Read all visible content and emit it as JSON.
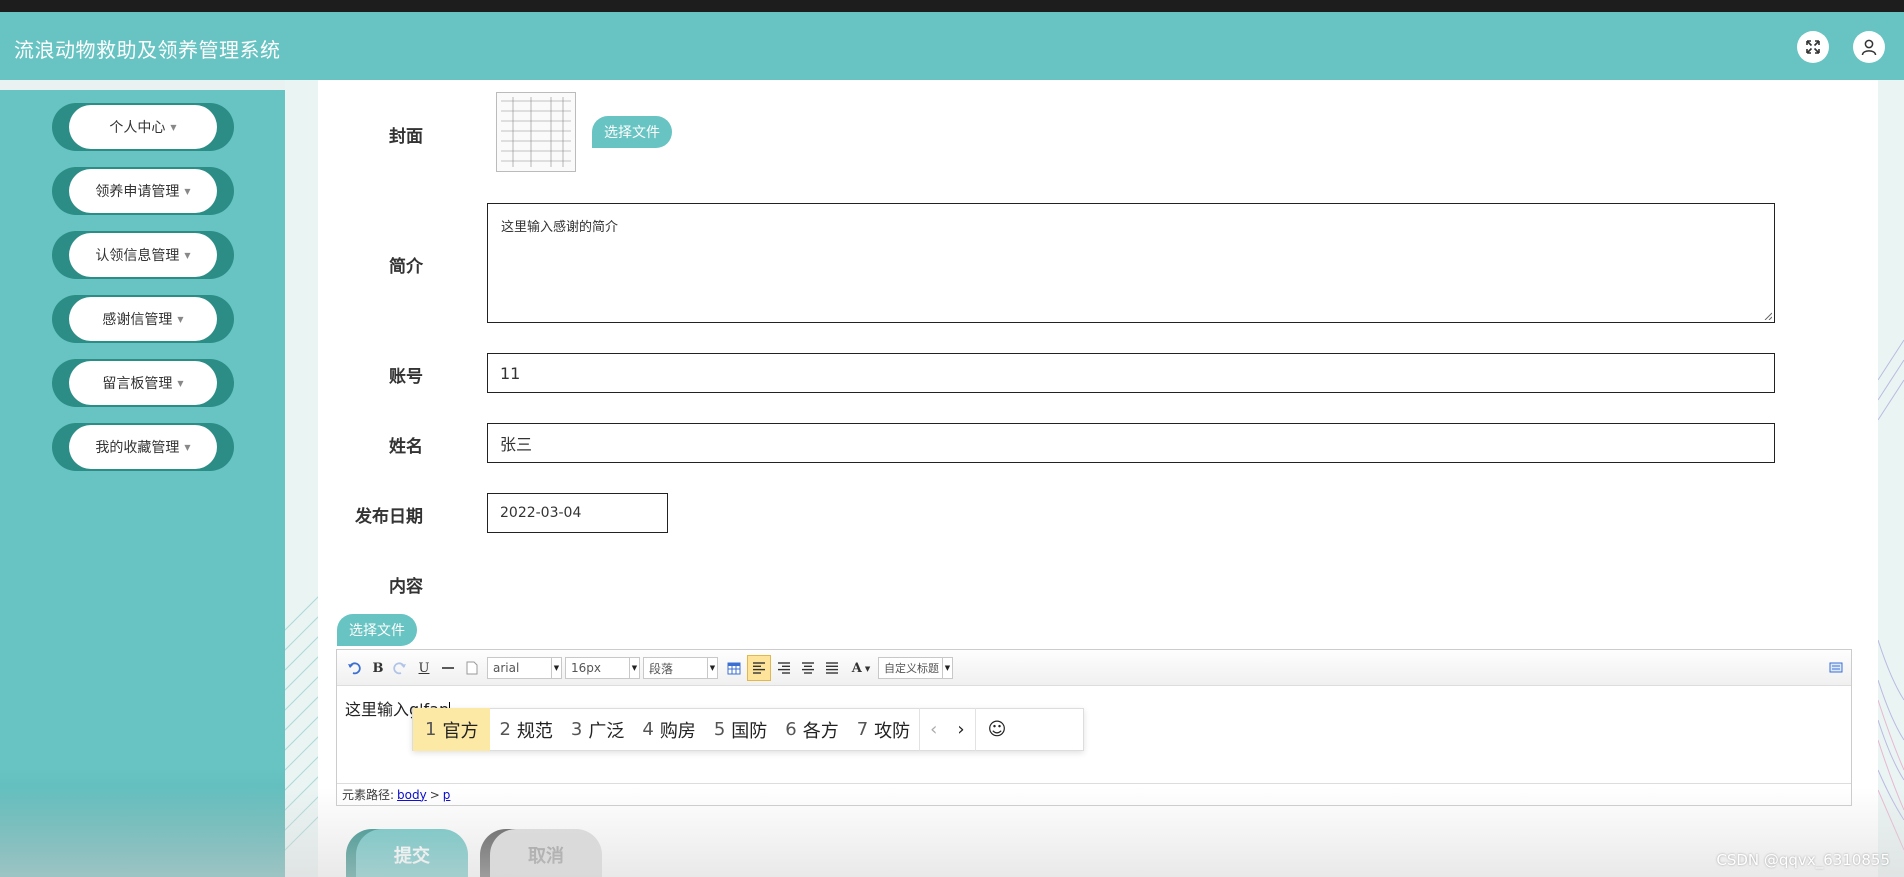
{
  "app": {
    "title": "流浪动物救助及领养管理系统"
  },
  "header": {
    "fullscreen_icon": "expand-arrows-icon",
    "user_icon": "user-avatar-icon"
  },
  "sidebar": {
    "items": [
      {
        "label": "个人中心"
      },
      {
        "label": "领养申请管理"
      },
      {
        "label": "认领信息管理"
      },
      {
        "label": "感谢信管理"
      },
      {
        "label": "留言板管理"
      },
      {
        "label": "我的收藏管理"
      }
    ]
  },
  "form": {
    "cover_label": "封面",
    "cover_button": "选择文件",
    "intro_label": "简介",
    "intro_value": "这里输入感谢的简介",
    "account_label": "账号",
    "account_value": "11",
    "name_label": "姓名",
    "name_value": "张三",
    "date_label": "发布日期",
    "date_value": "2022-03-04",
    "content_label": "内容",
    "content_file_button": "选择文件"
  },
  "editor": {
    "toolbar": {
      "bold": "B",
      "underline": "U",
      "font_family": "arial",
      "font_size": "16px",
      "paragraph": "段落",
      "font_color": "A",
      "custom_title": "自定义标题"
    },
    "text": "这里输入g'fan",
    "ime_candidates": [
      {
        "num": "1",
        "text": "官方"
      },
      {
        "num": "2",
        "text": "规范"
      },
      {
        "num": "3",
        "text": "广泛"
      },
      {
        "num": "4",
        "text": "购房"
      },
      {
        "num": "5",
        "text": "国防"
      },
      {
        "num": "6",
        "text": "各方"
      },
      {
        "num": "7",
        "text": "攻防"
      }
    ],
    "ime_prev": "‹",
    "ime_next": "›",
    "ime_emoji": "☺",
    "path_label": "元素路径:",
    "path_body": "body",
    "path_sep": ">",
    "path_p": "p"
  },
  "actions": {
    "submit": "提交",
    "cancel": "取消"
  },
  "watermark": "CSDN @qqvx_6310855",
  "colors": {
    "accent": "#67c4c3",
    "nav_dark": "#2c8c86",
    "cancel": "#e0e0e0"
  }
}
